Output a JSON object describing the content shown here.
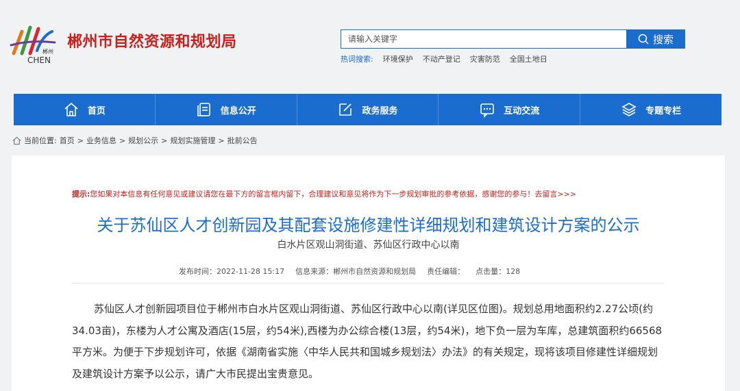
{
  "site": {
    "title": "郴州市自然资源和规划局",
    "logo_text": "郴州 CHEN"
  },
  "search": {
    "placeholder": "请输入关键字",
    "button_label": "搜索"
  },
  "hot_search": {
    "label": "热词搜索:",
    "items": [
      "环境保护",
      "不动产登记",
      "灾害防范",
      "全国土地日"
    ]
  },
  "nav": {
    "items": [
      {
        "label": "首页",
        "icon": "home-icon"
      },
      {
        "label": "信息公开",
        "icon": "document-icon"
      },
      {
        "label": "政务服务",
        "icon": "edit-icon"
      },
      {
        "label": "互动交流",
        "icon": "chat-icon"
      },
      {
        "label": "专题专栏",
        "icon": "layers-icon"
      }
    ]
  },
  "breadcrumb": {
    "prefix": "当前位置:",
    "items": [
      "首页",
      "业务信息",
      "规划公示",
      "规划实施管理",
      "批前公告"
    ],
    "separator": ">"
  },
  "article": {
    "tip_label": "提示:",
    "tip_text": "您如果对本信息有任何意见或建议请您在最下方的留言框内留下，合理建议和意见将作为下一步规划审批的参考依据，感谢您的参与！去留言>>>",
    "title": "关于苏仙区人才创新园及其配套设施修建性详细规划和建筑设计方案的公示",
    "subtitle": "白水片区观山洞街道、苏仙区行政中心以南",
    "meta": {
      "publish_time": "发布时间：2022-11-28 15:17",
      "source": "信息来源：郴州市自然资源和规划局",
      "editor": "责任编辑：",
      "clicks": "点击量：128"
    },
    "body": "苏仙区人才创新园项目位于郴州市白水片区观山洞街道、苏仙区行政中心以南(详见区位图)。规划总用地面积约2.27公顷(约34.03亩)，东楼为人才公寓及酒店(15层，约54米),西楼为办公综合楼(13层，约54米)，地下负一层为车库，总建筑面积约66568平方米。为便于下步规划许可，依据《湖南省实施〈中华人民共和国城乡规划法〉办法》的有关规定，现将该项目修建性详细规划及建筑设计方案予以公示，请广大市民提出宝贵意见。"
  },
  "colors": {
    "primary": "#1a6ccf",
    "brand_red": "#c8201c",
    "background": "#f1f2f4"
  }
}
